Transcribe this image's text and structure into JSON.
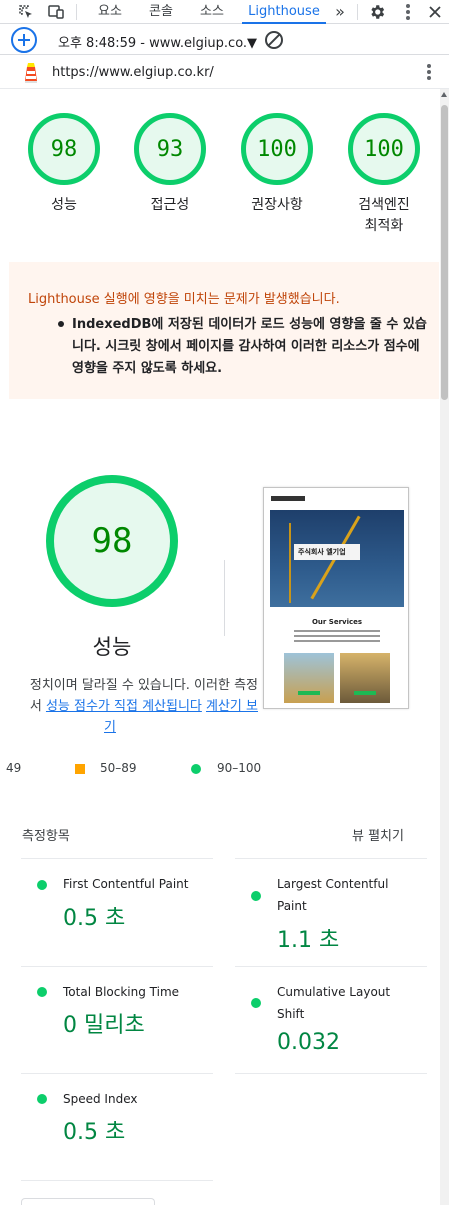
{
  "devtools": {
    "tabs": [
      "요소",
      "콘솔",
      "소스",
      "Lighthouse"
    ],
    "active_tab": "Lighthouse",
    "more_tabs": "»"
  },
  "toolbar": {
    "run_selector": "오후 8:48:59 - www.elgiup.co.▼"
  },
  "report": {
    "url": "https://www.elgiup.co.kr/"
  },
  "categories": [
    {
      "score": "98",
      "label": "성능"
    },
    {
      "score": "93",
      "label": "접근성"
    },
    {
      "score": "100",
      "label": "권장사항"
    },
    {
      "score": "100",
      "label": "검색엔진\n최적화"
    }
  ],
  "warning": {
    "title": "Lighthouse 실행에 영향을 미치는 문제가 발생했습니다.",
    "item": "IndexedDB에 저장된 데이터가 로드 성능에 영향을 줄 수 있습니다. 시크릿 창에서 페이지를 감사하여 이러한 리소스가 점수에 영향을 주지 않도록 하세요."
  },
  "performance": {
    "score": "98",
    "title": "성능",
    "desc_line1": "정치이며 달라질 수 있습니다. 이러한 측정",
    "desc_line2_prefix": "서 ",
    "desc_link1": "성능 점수가 직접 계산됩니다",
    "desc_link2": "계산기 보",
    "desc_link2_cont": "기"
  },
  "thumbnail": {
    "brand": "주식회사 엘기업",
    "services_heading": "Our Services"
  },
  "legend": {
    "fail": "49",
    "average": "50–89",
    "pass": "90–100"
  },
  "metrics": {
    "header": "측정항목",
    "expand": "뷰 펼치기",
    "items": [
      {
        "name": "First Contentful Paint",
        "value": "0.5 초"
      },
      {
        "name": "Largest Contentful Paint",
        "value": "1.1 초"
      },
      {
        "name": "Total Blocking Time",
        "value": "0 밀리초"
      },
      {
        "name": "Cumulative Layout Shift",
        "value": "0.032"
      },
      {
        "name": "Speed Index",
        "value": "0.5 초"
      }
    ]
  },
  "colors": {
    "pass": "#0cce6b",
    "average": "#ffa400",
    "accent": "#1a73e8"
  }
}
